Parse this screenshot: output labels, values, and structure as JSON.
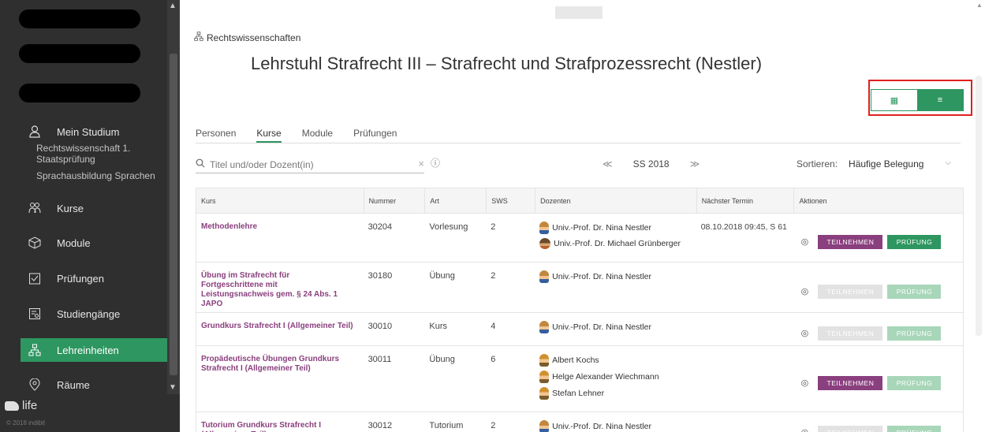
{
  "sidebar": {
    "profile": "Mein Studium",
    "sub_items": [
      "Rechtswissenschaft 1. Staatsprüfung",
      "Sprachausbildung Sprachen"
    ],
    "nav": [
      {
        "label": "Kurse",
        "icon": "people-icon"
      },
      {
        "label": "Module",
        "icon": "cube-icon"
      },
      {
        "label": "Prüfungen",
        "icon": "checklist-icon"
      },
      {
        "label": "Studiengänge",
        "icon": "document-search-icon"
      },
      {
        "label": "Lehreinheiten",
        "icon": "hierarchy-icon"
      },
      {
        "label": "Räume",
        "icon": "location-icon"
      }
    ],
    "logo": "life",
    "copyright": "© 2018 indibit"
  },
  "main": {
    "breadcrumb": "Rechtswissenschaften",
    "title": "Lehrstuhl Strafrecht III – Strafrecht und Strafprozessrecht (Nestler)",
    "view_toggle": {
      "grid": "▦",
      "list": "≡"
    },
    "tabs": [
      "Personen",
      "Kurse",
      "Module",
      "Prüfungen"
    ],
    "active_tab": "Kurse",
    "search": {
      "placeholder": "Titel und/oder Dozent(in)",
      "clear": "×",
      "info": "ⓘ"
    },
    "semester": {
      "prev": "≪",
      "current": "SS 2018",
      "next": "≫"
    },
    "sort": {
      "label": "Sortieren:",
      "value": "Häufige Belegung"
    }
  },
  "table": {
    "headers": [
      "Kurs",
      "Nummer",
      "Art",
      "SWS",
      "Dozenten",
      "Nächster Termin",
      "Aktionen"
    ],
    "rows": [
      {
        "kurs": "Methodenlehre",
        "nummer": "30204",
        "art": "Vorlesung",
        "sws": "2",
        "dozenten": [
          "Univ.-Prof. Dr. Nina Nestler",
          "Univ.-Prof. Dr. Michael Grünberger"
        ],
        "next": "08.10.2018 09:45, S 61",
        "join": "TEILNEHMEN",
        "exam": "PRÜFUNG"
      },
      {
        "kurs": "Übung im Strafrecht für Fortgeschrittene mit Leistungsnachweis gem. § 24 Abs. 1 JAPO",
        "nummer": "30180",
        "art": "Übung",
        "sws": "2",
        "dozenten": [
          "Univ.-Prof. Dr. Nina Nestler"
        ],
        "next": "",
        "join": "TEILNEHMEN",
        "exam": "PRÜFUNG"
      },
      {
        "kurs": "Grundkurs Strafrecht I (Allgemeiner Teil)",
        "nummer": "30010",
        "art": "Kurs",
        "sws": "4",
        "dozenten": [
          "Univ.-Prof. Dr. Nina Nestler"
        ],
        "next": "",
        "join": "TEILNEHMEN",
        "exam": "PRÜFUNG"
      },
      {
        "kurs": "Propädeutische Übungen Grundkurs Strafrecht I (Allgemeiner Teil)",
        "nummer": "30011",
        "art": "Übung",
        "sws": "6",
        "dozenten": [
          "Albert Kochs",
          "Helge Alexander Wiechmann",
          "Stefan Lehner"
        ],
        "next": "",
        "join": "TEILNEHMEN",
        "exam": "PRÜFUNG"
      },
      {
        "kurs": "Tutorium Grundkurs Strafrecht I (Allgemeiner Teil)",
        "nummer": "30012",
        "art": "Tutorium",
        "sws": "2",
        "dozenten": [
          "Univ.-Prof. Dr. Nina Nestler"
        ],
        "next": "",
        "join": "TEILNEHMEN",
        "exam": "PRÜFUNG"
      }
    ]
  },
  "colors": {
    "accent": "#2e9660",
    "course_link": "#8a3f7e",
    "sidebar": "#2f2f2f",
    "highlight": "#e0201f"
  }
}
